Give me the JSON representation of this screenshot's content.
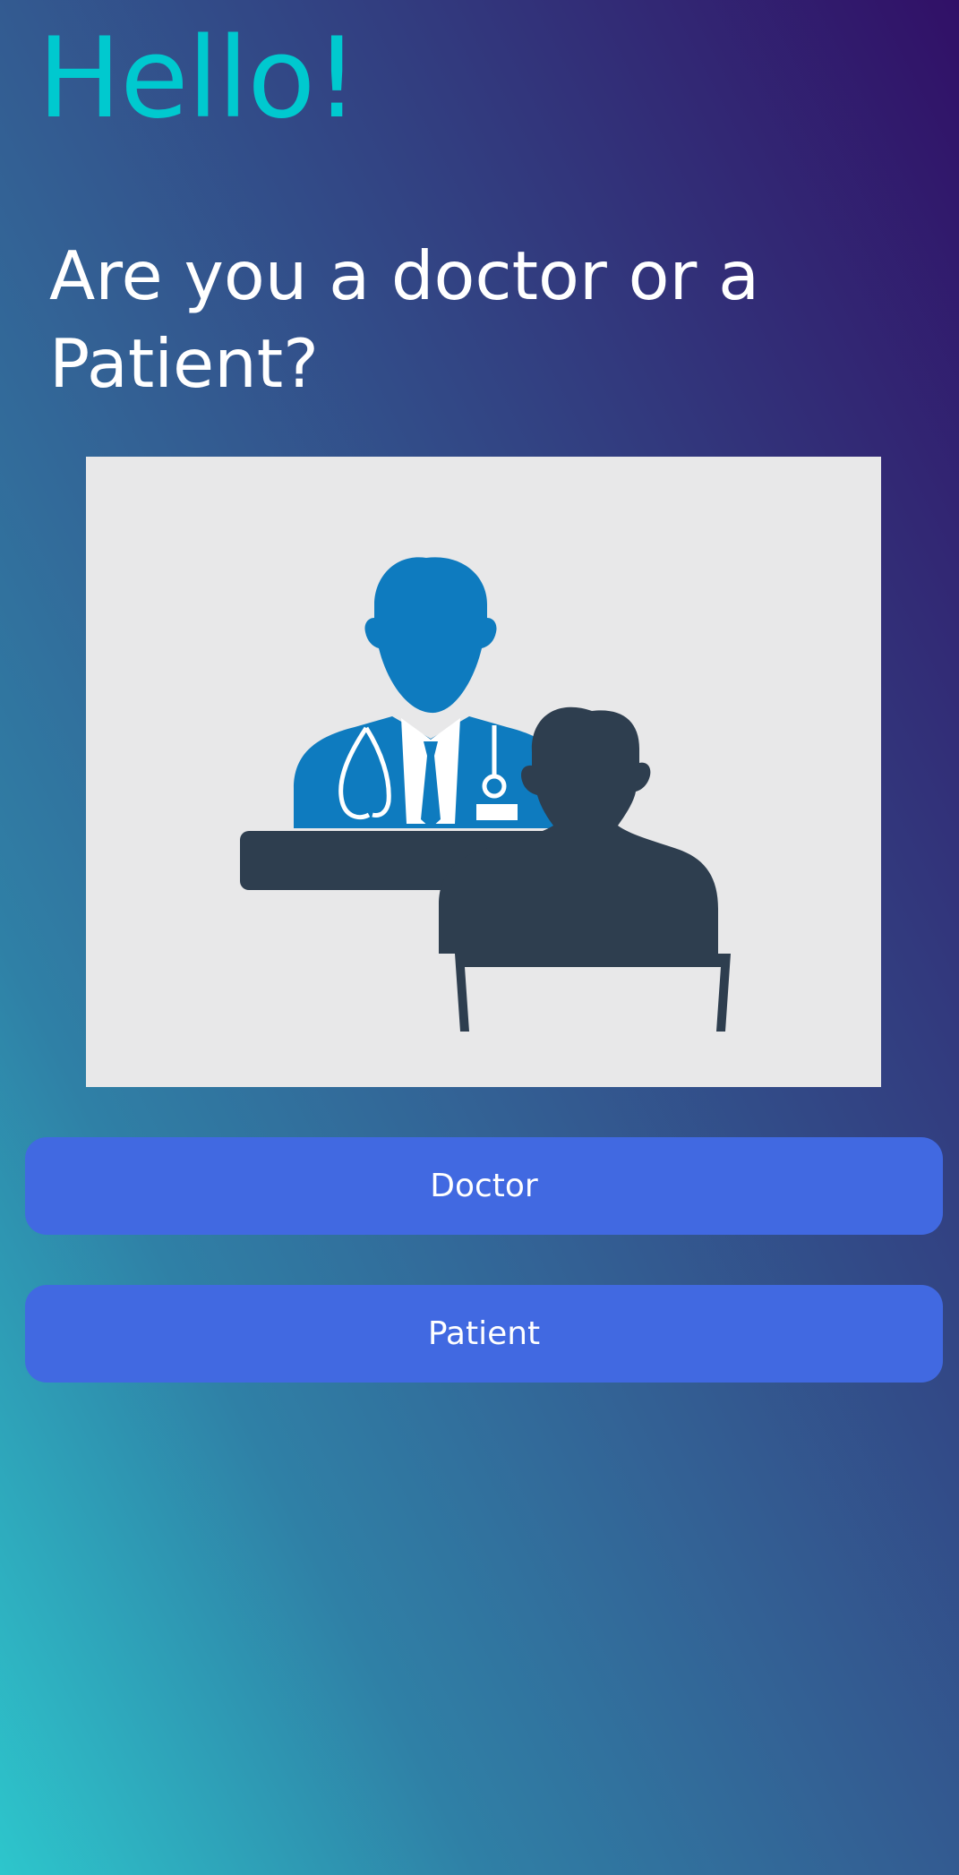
{
  "greeting": "Hello!",
  "question": "Are you a doctor or a Patient?",
  "illustration": {
    "icon": "doctor-patient-consultation-icon",
    "background_color": "#e8e8e9",
    "doctor_color": "#0e7bbf",
    "patient_color": "#2e3e4f"
  },
  "buttons": {
    "doctor_label": "Doctor",
    "patient_label": "Patient"
  },
  "colors": {
    "greeting": "#00c9cf",
    "button": "#4169e1",
    "gradient_top": "#311067",
    "gradient_bottom": "#2dc6cc"
  }
}
